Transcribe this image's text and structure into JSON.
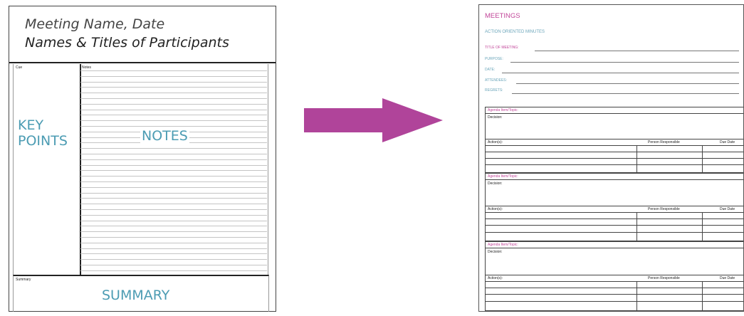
{
  "left_page": {
    "meeting_name": "Meeting Name, Date",
    "participants": "Names & Titles of Participants",
    "cue_label": "Cue",
    "notes_label": "Notes",
    "summary_label": "Summary",
    "key_points_line1": "KEY",
    "key_points_line2": "POINTS",
    "notes_big": "NOTES",
    "summary_big": "SUMMARY"
  },
  "colors": {
    "accent_teal": "#4c9cb3",
    "accent_pink": "#c2479a",
    "arrow": "#b0449a"
  },
  "right_page": {
    "title": "MEETINGS",
    "subtitle": "ACTION ORIENTED MINUTES",
    "fields": [
      {
        "label": "TITLE OF MEETING:"
      },
      {
        "label": "PURPOSE:"
      },
      {
        "label": "DATE:"
      },
      {
        "label": "ATTENDEES:"
      },
      {
        "label": "REGRETS:"
      }
    ],
    "agenda_blocks": [
      {
        "topic": "Agenda Item/Topic:",
        "decision": "Decision:",
        "actions": "Action(s):",
        "person": "Person Responsible",
        "due": "Due Date"
      },
      {
        "topic": "Agenda Item/Topic:",
        "decision": "Decision:",
        "actions": "Action(s):",
        "person": "Person Responsible",
        "due": "Due Date"
      },
      {
        "topic": "Agenda Item/Topic:",
        "decision": "Decision:",
        "actions": "Action(s):",
        "person": "Person Responsible",
        "due": "Due Date"
      }
    ]
  }
}
